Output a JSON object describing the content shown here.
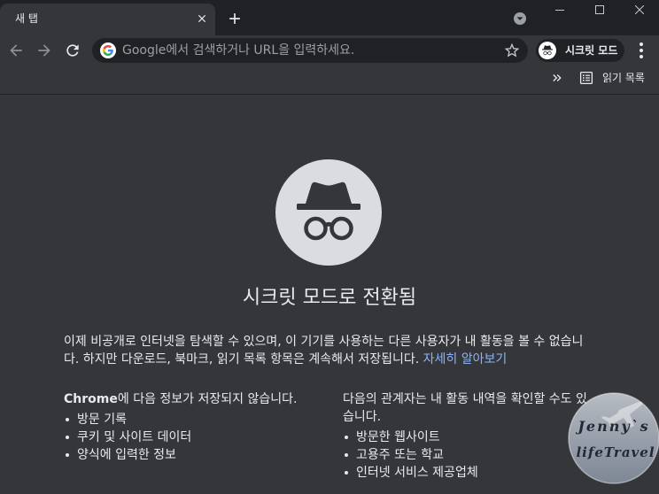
{
  "tabs": [
    {
      "title": "새 탭"
    }
  ],
  "toolbar": {
    "omnibox": {
      "placeholder": "Google에서 검색하거나 URL을 입력하세요."
    },
    "profile_label": "시크릿 모드"
  },
  "bookmarks_bar": {
    "reading_list_label": "읽기 목록"
  },
  "ntp": {
    "title": "시크릿 모드로 전환됨",
    "description": "이제 비공개로 인터넷을 탐색할 수 있으며, 이 기기를 사용하는 다른 사용자가 내 활동을 볼 수 없습니다. 하지만 다운로드, 북마크, 읽기 목록 항목은 계속해서 저장됩니다.",
    "learn_more": "자세히 알아보기",
    "not_saved": {
      "heading_brand": "Chrome",
      "heading_rest": "에 다음 정보가 저장되지 않습니다.",
      "items": [
        "방문 기록",
        "쿠키 및 사이트 데이터",
        "양식에 입력한 정보"
      ]
    },
    "may_see": {
      "heading": "다음의 관계자는 내 활동 내역을 확인할 수도 있습니다.",
      "items": [
        "방문한 웹사이트",
        "고용주 또는 학교",
        "인터넷 서비스 제공업체"
      ]
    }
  },
  "watermark": {
    "line1": "Jenny`s",
    "line2": "lifeTravel"
  },
  "icons": {
    "tab_close": "close-icon",
    "new_tab": "plus-icon",
    "tab_search": "chevron-down-circle-icon",
    "minimize": "minimize-icon",
    "maximize": "maximize-icon",
    "window_close": "close-icon",
    "back": "arrow-left-icon",
    "forward": "arrow-right-icon",
    "reload": "reload-icon",
    "omnibox_search_engine": "google-g-icon",
    "bookmark_star": "star-outline-icon",
    "profile": "incognito-icon",
    "menu": "more-vert-icon",
    "bookmarks_overflow": "double-chevron-right-icon",
    "reading_list": "reading-list-icon",
    "hero": "incognito-icon"
  },
  "colors": {
    "frame": "#202124",
    "toolbar": "#35363a",
    "omnibox": "#202124",
    "ntp_background": "#35363a",
    "text": "#e8eaed",
    "secondary_text": "#9aa0a6",
    "link": "#8ab4f8",
    "illustration_circle": "#dadce0",
    "illustration_glyph": "#35363a"
  }
}
